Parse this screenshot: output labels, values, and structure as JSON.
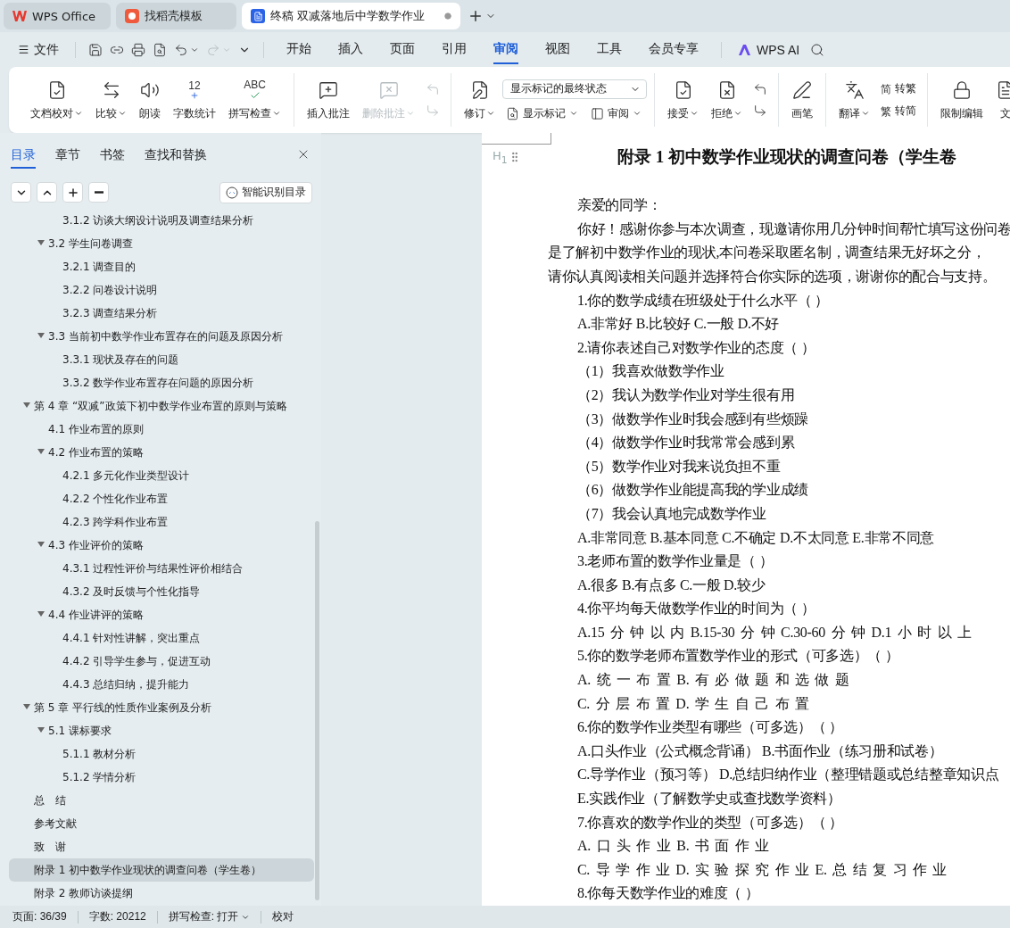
{
  "tabs": [
    {
      "label": "WPS Office",
      "kind": "wps",
      "selected": false
    },
    {
      "label": "找稻壳模板",
      "kind": "docer",
      "selected": false
    },
    {
      "label": "终稿 双减落地后中学数学作业",
      "kind": "writer",
      "selected": true
    }
  ],
  "menu": {
    "file": "文件",
    "items": [
      {
        "label": "开始",
        "selected": false
      },
      {
        "label": "插入",
        "selected": false
      },
      {
        "label": "页面",
        "selected": false
      },
      {
        "label": "引用",
        "selected": false
      },
      {
        "label": "审阅",
        "selected": true
      },
      {
        "label": "视图",
        "selected": false
      },
      {
        "label": "工具",
        "selected": false
      },
      {
        "label": "会员专享",
        "selected": false
      }
    ],
    "ai": "WPS AI"
  },
  "ribbon": [
    {
      "items": [
        {
          "kind": "proofread",
          "label": "文档校对",
          "menu": true,
          "disabled": false
        },
        {
          "kind": "compare",
          "label": "比较",
          "menu": true,
          "disabled": false
        },
        {
          "kind": "read",
          "label": "朗读",
          "menu": false,
          "disabled": false
        },
        {
          "kind": "count",
          "label": "字数统计",
          "glyph": "12",
          "menu": false,
          "disabled": false
        },
        {
          "kind": "spell",
          "label": "拼写检查",
          "glyph": "ABC",
          "menu": true,
          "disabled": false
        }
      ]
    },
    {
      "items": [
        {
          "kind": "comment",
          "label": "插入批注",
          "menu": false,
          "disabled": false
        },
        {
          "kind": "uncomment",
          "label": "删除批注",
          "menu": true,
          "disabled": true
        }
      ],
      "side": [
        {
          "kind": "prev",
          "disabled": true
        },
        {
          "kind": "next",
          "disabled": true
        }
      ]
    },
    {
      "items": [
        {
          "kind": "track",
          "label": "修订",
          "menu": true,
          "disabled": false
        }
      ],
      "select": "显示标记的最终状态",
      "small": [
        {
          "kind": "markup",
          "label": "显示标记",
          "menu": true,
          "disabled": false
        },
        {
          "kind": "pane",
          "label": "审阅",
          "menu": true,
          "disabled": false
        }
      ]
    },
    {
      "items": [
        {
          "kind": "accept",
          "label": "接受",
          "menu": true,
          "disabled": false
        },
        {
          "kind": "reject",
          "label": "拒绝",
          "menu": true,
          "disabled": false
        }
      ],
      "side": [
        {
          "kind": "prev",
          "disabled": false
        },
        {
          "kind": "next",
          "disabled": false
        }
      ]
    },
    {
      "items": [
        {
          "kind": "pen",
          "label": "画笔",
          "menu": false,
          "disabled": false
        }
      ]
    },
    {
      "items": [
        {
          "kind": "translate",
          "label": "翻译",
          "menu": true,
          "disabled": false
        }
      ],
      "small": [
        {
          "kind": "glyph",
          "glyph": "简",
          "label": "转繁",
          "menu": false,
          "disabled": false
        },
        {
          "kind": "glyph",
          "glyph": "繁",
          "label": "转简",
          "menu": false,
          "disabled": false
        }
      ]
    },
    {
      "items": [
        {
          "kind": "restrict",
          "label": "限制编辑",
          "menu": false,
          "disabled": false
        },
        {
          "kind": "doc",
          "label": "文",
          "menu": false,
          "disabled": false
        }
      ]
    }
  ],
  "sidebar": {
    "tabs": [
      {
        "label": "目录",
        "selected": true
      },
      {
        "label": "章节",
        "selected": false
      },
      {
        "label": "书签",
        "selected": false
      },
      {
        "label": "查找和替换",
        "selected": false
      }
    ],
    "smart_button": "智能识别目录",
    "toc": [
      {
        "children": [
          {
            "children": [
              {
                "label": "3.1.2 访谈大纲设计说明及调查结果分析",
                "selected": false
              }
            ]
          },
          {
            "label": "3.2 学生问卷调查",
            "expanded": true,
            "selected": false,
            "children": [
              {
                "label": "3.2.1 调查目的",
                "selected": false
              },
              {
                "label": "3.2.2 问卷设计说明",
                "selected": false
              },
              {
                "label": "3.2.3 调查结果分析",
                "selected": false
              }
            ]
          },
          {
            "label": "3.3 当前初中数学作业布置存在的问题及原因分析",
            "expanded": true,
            "selected": false,
            "children": [
              {
                "label": "3.3.1 现状及存在的问题",
                "selected": false
              },
              {
                "label": "3.3.2 数学作业布置存在问题的原因分析",
                "selected": false
              }
            ]
          }
        ]
      },
      {
        "label": "第 4 章 “双减”政策下初中数学作业布置的原则与策略",
        "expanded": true,
        "selected": false,
        "children": [
          {
            "label": "4.1  作业布置的原则",
            "selected": false
          },
          {
            "label": "4.2  作业布置的策略",
            "expanded": true,
            "selected": false,
            "children": [
              {
                "label": "4.2.1 多元化作业类型设计",
                "selected": false
              },
              {
                "label": "4.2.2 个性化作业布置",
                "selected": false
              },
              {
                "label": "4.2.3 跨学科作业布置",
                "selected": false
              }
            ]
          },
          {
            "label": "4.3  作业评价的策略",
            "expanded": true,
            "selected": false,
            "children": [
              {
                "label": "4.3.1 过程性评价与结果性评价相结合",
                "selected": false
              },
              {
                "label": "4.3.2 及时反馈与个性化指导",
                "selected": false
              }
            ]
          },
          {
            "label": "4.4  作业讲评的策略",
            "expanded": true,
            "selected": false,
            "children": [
              {
                "label": "4.4.1 针对性讲解，突出重点",
                "selected": false
              },
              {
                "label": "4.4.2 引导学生参与，促进互动",
                "selected": false
              },
              {
                "label": "4.4.3 总结归纳，提升能力",
                "selected": false
              }
            ]
          }
        ]
      },
      {
        "label": "第 5 章  平行线的性质作业案例及分析",
        "expanded": true,
        "selected": false,
        "children": [
          {
            "label": "5.1 课标要求",
            "expanded": true,
            "selected": false,
            "children": [
              {
                "label": "5.1.1 教材分析",
                "selected": false
              },
              {
                "label": "5.1.2 学情分析",
                "selected": false
              }
            ]
          }
        ]
      },
      {
        "label": "总　结",
        "selected": false
      },
      {
        "label": "参考文献",
        "selected": false
      },
      {
        "label": "致　谢",
        "selected": false
      },
      {
        "label": "附录 1  初中数学作业现状的调查问卷（学生卷）",
        "selected": true
      },
      {
        "label": "附录 2  教师访谈提纲",
        "selected": false
      }
    ]
  },
  "document": {
    "heading_marker": "H$_{1}$",
    "title": "附录 1  初中数学作业现状的调查问卷（学生卷",
    "lines": [
      {
        "kind": "indent",
        "text": "亲爱的同学："
      },
      {
        "kind": "indent",
        "text": "你好！感谢你参与本次调查，现邀请你用几分钟时间帮忙填写这份问卷"
      },
      {
        "kind": "flush",
        "text": "是了解初中数学作业的现状,本问卷采取匿名制，调查结果无好坏之分，"
      },
      {
        "kind": "flush",
        "text": "请你认真阅读相关问题并选择符合你实际的选项，谢谢你的配合与支持。"
      },
      {
        "kind": "indent",
        "text": "1.你的数学成绩在班级处于什么水平（  ）"
      },
      {
        "kind": "indent",
        "text": "A.非常好  B.比较好  C.一般  D.不好"
      },
      {
        "kind": "indent",
        "text": "2.请你表述自己对数学作业的态度（  ）"
      },
      {
        "kind": "indent",
        "text": "（1）我喜欢做数学作业"
      },
      {
        "kind": "indent",
        "text": "（2）我认为数学作业对学生很有用"
      },
      {
        "kind": "indent",
        "text": "（3）做数学作业时我会感到有些烦躁"
      },
      {
        "kind": "indent",
        "text": "（4）做数学作业时我常常会感到累"
      },
      {
        "kind": "indent",
        "text": "（5）数学作业对我来说负担不重"
      },
      {
        "kind": "indent",
        "text": "（6）做数学作业能提高我的学业成绩"
      },
      {
        "kind": "indent",
        "text": "（7）我会认真地完成数学作业"
      },
      {
        "kind": "indent",
        "text": "A.非常同意  B.基本同意  C.不确定  D.不太同意  E.非常不同意"
      },
      {
        "kind": "indent",
        "text": "3.老师布置的数学作业量是（  ）"
      },
      {
        "kind": "indent",
        "text": "A.很多  B.有点多  C.一般  D.较少"
      },
      {
        "kind": "indent",
        "text": "4.你平均每天做数学作业的时间为（  ）"
      },
      {
        "kind": "spaced",
        "text": "A.15 分 钟 以 内 B.15-30 分 钟 C.30-60 分 钟 D.1 小 时 以 上"
      },
      {
        "kind": "indent",
        "text": "5.你的数学老师布置数学作业的形式（可多选）（  ）"
      },
      {
        "kind": "spaced",
        "text": "A. 统 一 布 置 B. 有 必 做 题 和 选 做 题"
      },
      {
        "kind": "spaced",
        "text": "C. 分 层 布 置 D. 学 生 自 己 布 置"
      },
      {
        "kind": "indent",
        "text": "6.你的数学作业类型有哪些（可多选）（  ）"
      },
      {
        "kind": "indent",
        "text": "A.口头作业（公式概念背诵）  B.书面作业（练习册和试卷）"
      },
      {
        "kind": "indent",
        "text": "C.导学作业（预习等）  D.总结归纳作业（整理错题或总结整章知识点"
      },
      {
        "kind": "indent",
        "text": "E.实践作业（了解数学史或查找数学资料）"
      },
      {
        "kind": "indent",
        "text": "7.你喜欢的数学作业的类型（可多选）（  ）"
      },
      {
        "kind": "spaced",
        "text": "A. 口 头 作 业 B. 书 面 作 业"
      },
      {
        "kind": "spaced",
        "text": "C. 导 学 作 业 D. 实 验 探 究 作 业 E. 总 结 复 习 作 业"
      },
      {
        "kind": "indent",
        "text": "8.你每天数学作业的难度（  ）"
      }
    ]
  },
  "status": [
    {
      "text": "页面: 36/39",
      "menu": false
    },
    {
      "text": "字数: 20212",
      "menu": false
    },
    {
      "text": "拼写检查: 打开",
      "menu": true
    },
    {
      "text": "校对",
      "menu": false
    }
  ]
}
